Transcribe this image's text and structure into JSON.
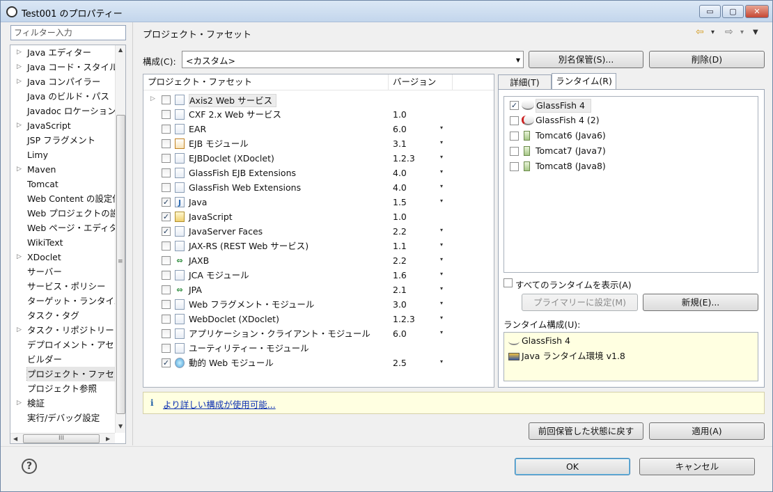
{
  "window": {
    "title": "Test001 のプロパティー",
    "min": "▭",
    "max": "▢",
    "close": "✕"
  },
  "filter": {
    "placeholder": "フィルター入力"
  },
  "sidebar": {
    "items": [
      {
        "label": "Java エディター",
        "expand": "▷"
      },
      {
        "label": "Java コード・スタイル",
        "expand": "▷"
      },
      {
        "label": "Java コンパイラー",
        "expand": "▷"
      },
      {
        "label": "Java のビルド・パス",
        "expand": ""
      },
      {
        "label": "Javadoc ロケーション",
        "expand": ""
      },
      {
        "label": "JavaScript",
        "expand": "▷"
      },
      {
        "label": "JSP フラグメント",
        "expand": ""
      },
      {
        "label": "Limy",
        "expand": ""
      },
      {
        "label": "Maven",
        "expand": "▷"
      },
      {
        "label": "Tomcat",
        "expand": ""
      },
      {
        "label": "Web Content の設定値",
        "expand": ""
      },
      {
        "label": "Web プロジェクトの設定",
        "expand": ""
      },
      {
        "label": "Web ページ・エディター",
        "expand": ""
      },
      {
        "label": "WikiText",
        "expand": ""
      },
      {
        "label": "XDoclet",
        "expand": "▷"
      },
      {
        "label": "サーバー",
        "expand": ""
      },
      {
        "label": "サービス・ポリシー",
        "expand": ""
      },
      {
        "label": "ターゲット・ランタイム",
        "expand": ""
      },
      {
        "label": "タスク・タグ",
        "expand": ""
      },
      {
        "label": "タスク・リポジトリー",
        "expand": "▷"
      },
      {
        "label": "デプロイメント・アセンブリー",
        "expand": ""
      },
      {
        "label": "ビルダー",
        "expand": ""
      },
      {
        "label": "プロジェクト・ファセット",
        "expand": ""
      },
      {
        "label": "プロジェクト参照",
        "expand": ""
      },
      {
        "label": "検証",
        "expand": "▷"
      },
      {
        "label": "実行/デバッグ設定",
        "expand": ""
      }
    ],
    "selected_index": 22,
    "scroll_grip": "≡",
    "hscroll_grip": "III"
  },
  "page": {
    "title": "プロジェクト・ファセット"
  },
  "nav": {
    "back": "⇦",
    "forward": "⇨",
    "drop": "▾",
    "menu": "▼"
  },
  "config": {
    "label": "構成(C):",
    "value": "<カスタム>",
    "save_as": "別名保管(S)...",
    "delete": "削除(D)"
  },
  "table": {
    "col_facet": "プロジェクト・ファセット",
    "col_version": "バージョン",
    "rows": [
      {
        "name": "Axis2 Web サービス",
        "version": "",
        "checked": false,
        "icon": "doc",
        "dd": false,
        "expand": true
      },
      {
        "name": "CXF 2.x Web サービス",
        "version": "1.0",
        "checked": false,
        "icon": "doc",
        "dd": false
      },
      {
        "name": "EAR",
        "version": "6.0",
        "checked": false,
        "icon": "doc",
        "dd": true
      },
      {
        "name": "EJB モジュール",
        "version": "3.1",
        "checked": false,
        "icon": "ejb",
        "dd": true
      },
      {
        "name": "EJBDoclet (XDoclet)",
        "version": "1.2.3",
        "checked": false,
        "icon": "doc",
        "dd": true
      },
      {
        "name": "GlassFish EJB Extensions",
        "version": "4.0",
        "checked": false,
        "icon": "doc",
        "dd": true
      },
      {
        "name": "GlassFish Web Extensions",
        "version": "4.0",
        "checked": false,
        "icon": "doc",
        "dd": true
      },
      {
        "name": "Java",
        "version": "1.5",
        "checked": true,
        "icon": "java",
        "dd": true
      },
      {
        "name": "JavaScript",
        "version": "1.0",
        "checked": true,
        "icon": "js",
        "dd": false
      },
      {
        "name": "JavaServer Faces",
        "version": "2.2",
        "checked": true,
        "icon": "doc",
        "dd": true
      },
      {
        "name": "JAX-RS (REST Web サービス)",
        "version": "1.1",
        "checked": false,
        "icon": "doc",
        "dd": true
      },
      {
        "name": "JAXB",
        "version": "2.2",
        "checked": false,
        "icon": "bind",
        "dd": true
      },
      {
        "name": "JCA モジュール",
        "version": "1.6",
        "checked": false,
        "icon": "doc",
        "dd": true
      },
      {
        "name": "JPA",
        "version": "2.1",
        "checked": false,
        "icon": "bind",
        "dd": true
      },
      {
        "name": "Web フラグメント・モジュール",
        "version": "3.0",
        "checked": false,
        "icon": "doc",
        "dd": true
      },
      {
        "name": "WebDoclet (XDoclet)",
        "version": "1.2.3",
        "checked": false,
        "icon": "doc",
        "dd": true
      },
      {
        "name": "アプリケーション・クライアント・モジュール",
        "version": "6.0",
        "checked": false,
        "icon": "doc",
        "dd": true
      },
      {
        "name": "ユーティリティー・モジュール",
        "version": "",
        "checked": false,
        "icon": "doc",
        "dd": false
      },
      {
        "name": "動的 Web モジュール",
        "version": "2.5",
        "checked": true,
        "icon": "web",
        "dd": true
      }
    ]
  },
  "tabs": {
    "details": "詳細(T)",
    "runtime": "ランタイム(R)"
  },
  "runtimes": {
    "items": [
      {
        "name": "GlassFish 4",
        "checked": true,
        "icon": "gf"
      },
      {
        "name": "GlassFish 4 (2)",
        "checked": false,
        "icon": "gferr"
      },
      {
        "name": "Tomcat6 (Java6)",
        "checked": false,
        "icon": "tc"
      },
      {
        "name": "Tomcat7 (Java7)",
        "checked": false,
        "icon": "tc"
      },
      {
        "name": "Tomcat8 (Java8)",
        "checked": false,
        "icon": "tc"
      }
    ],
    "show_all": "すべてのランタイムを表示(A)",
    "make_primary": "プライマリーに設定(M)",
    "new": "新規(E)...",
    "composition_label": "ランタイム構成(U):",
    "composition": [
      {
        "name": "GlassFish 4",
        "icon": "gf"
      },
      {
        "name": "Java ランタイム環境 v1.8",
        "icon": "jre"
      }
    ]
  },
  "info": {
    "icon": "i",
    "link": "より詳しい構成が使用可能..."
  },
  "buttons": {
    "restore": "前回保管した状態に戻す",
    "apply": "適用(A)",
    "ok": "OK",
    "cancel": "キャンセル"
  },
  "help": {
    "glyph": "?"
  },
  "icons": {
    "check": "✓",
    "expand": "▷",
    "dropdown": "▾",
    "combo_arrow": "▼",
    "up": "▲",
    "down": "▼",
    "left": "◀",
    "right": "▶"
  },
  "colors": {
    "accent": "#1c5da7",
    "link": "#0b2fb2",
    "info_bg": "#ffffe1",
    "error": "#cc2222",
    "java": "#2f6db3"
  }
}
